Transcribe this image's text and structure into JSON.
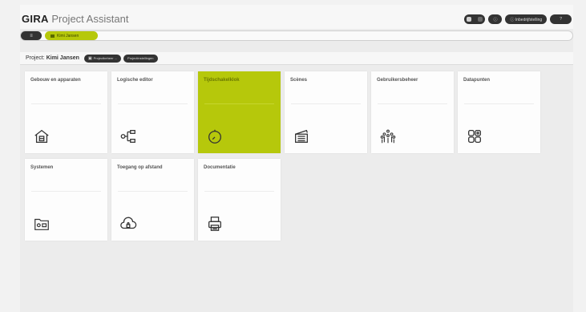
{
  "header": {
    "brand": "GIRA",
    "subtitle": "Project Assistant",
    "controls": {
      "toggle_label": "",
      "updates_label": "ⓘ ",
      "settings_label": "ⓘ Inbedrijfstelling",
      "help_label": "?"
    }
  },
  "breadcrumb": {
    "home_label": "≡",
    "project_label": "Kimi Jansen"
  },
  "project": {
    "prefix": "Project:",
    "name": "Kimi Jansen",
    "btn_manage": "Projectbeheer ...",
    "btn_settings": "Projectinstellingen"
  },
  "tiles": [
    {
      "label": "Gebouw en apparaten",
      "icon": "building-icon",
      "active": false
    },
    {
      "label": "Logische editor",
      "icon": "logic-editor-icon",
      "active": false
    },
    {
      "label": "Tijdschakelklok",
      "icon": "timer-clock-icon",
      "active": true
    },
    {
      "label": "Scènes",
      "icon": "scene-clapper-icon",
      "active": false
    },
    {
      "label": "Gebruikersbeheer",
      "icon": "users-icon",
      "active": false
    },
    {
      "label": "Datapunten",
      "icon": "datapoints-icon",
      "active": false
    },
    {
      "label": "Systemen",
      "icon": "systems-icon",
      "active": false
    },
    {
      "label": "Toegang op afstand",
      "icon": "remote-access-cloud-icon",
      "active": false
    },
    {
      "label": "Documentatie",
      "icon": "printer-icon",
      "active": false
    }
  ],
  "colors": {
    "accent": "#b6c80b",
    "dark_pill": "#333333",
    "background": "#ececec"
  }
}
